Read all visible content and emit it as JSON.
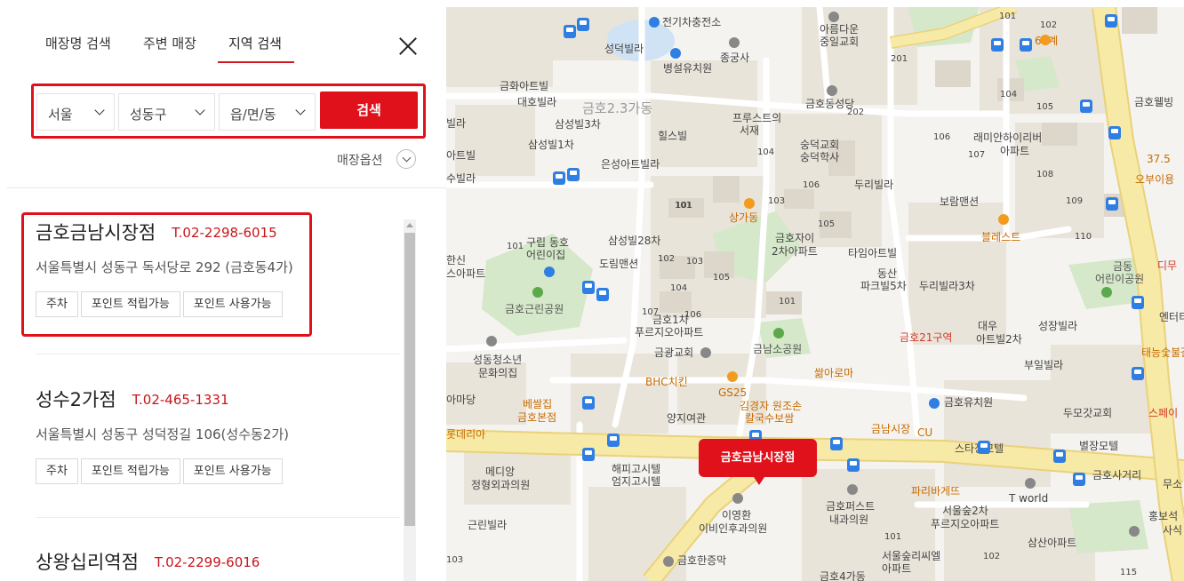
{
  "tabs": [
    {
      "label": "매장명 검색",
      "active": false
    },
    {
      "label": "주변 매장",
      "active": false
    },
    {
      "label": "지역 검색",
      "active": true
    }
  ],
  "search": {
    "city": "서울",
    "district": "성동구",
    "town": "읍/면/동",
    "button_label": "검색"
  },
  "store_options_label": "매장옵션",
  "stores": [
    {
      "name": "금호금남시장점",
      "tel": "T.02-2298-6015",
      "address": "서울특별시 성동구 독서당로 292 (금호동4가)",
      "tags": [
        "주차",
        "포인트 적립가능",
        "포인트 사용가능"
      ],
      "selected": true
    },
    {
      "name": "성수2가점",
      "tel": "T.02-465-1331",
      "address": "서울특별시 성동구 성덕정길 106(성수동2가)",
      "tags": [
        "주차",
        "포인트 적립가능",
        "포인트 사용가능"
      ],
      "selected": false
    },
    {
      "name": "상왕십리역점",
      "tel": "T.02-2299-6016",
      "address": "",
      "tags": [],
      "selected": false
    }
  ],
  "map": {
    "marker_label": "금호금남시장점",
    "labels": {
      "l1": "전기차충전소",
      "l2": "아름다운",
      "l3": "중일교회",
      "l4": "성덕빌라",
      "l5": "종궁사",
      "l6": "병설유치원",
      "l7": "금화아트빌",
      "l8": "대호빌라",
      "l9": "금호2.3가동",
      "l10": "금호동성당",
      "l11": "삼성빌3차",
      "l12": "프루스트의",
      "l13": "서재",
      "l14": "힐스빌",
      "l15": "숭덕교회",
      "l16": "숭덕학사",
      "l17": "삼성빌1차",
      "l18": "래미안하이리버",
      "l19": "아파트",
      "l20": "은성아트빌라",
      "l21": "두리빌라",
      "l22": "보람맨션",
      "l23": "상가동",
      "l24": "블레스트",
      "l25": "구립 동호",
      "l26": "어린이집",
      "l27": "삼성빌28차",
      "l28": "금호자이",
      "l29": "2차아파트",
      "l30": "타임아트빌",
      "l31": "도림맨션",
      "l32": "동산",
      "l33": "파크빌5차",
      "l34": "두리빌라3차",
      "l35": "금동",
      "l36": "어린이공원",
      "l37": "금호근린공원",
      "l38": "금호1차",
      "l39": "푸르지오아파트",
      "l40": "금광교회",
      "l41": "금남소공원",
      "l42": "대우",
      "l43": "아트빌2차",
      "l44": "성장빌라",
      "l45": "금호21구역",
      "l46": "성동청소년",
      "l47": "문화의집",
      "l48": "부일빌라",
      "l49": "BHC치킨",
      "l50": "GS25",
      "l51": "쌂아로마",
      "l52": "베쌀집",
      "l53": "금호본점",
      "l54": "김경자 원조손",
      "l55": "칼국수보쌈",
      "l56": "금호유치원",
      "l57": "양지여관",
      "l58": "두모갓교회",
      "l59": "금남시장",
      "l60": "CU",
      "l61": "스타장모텔",
      "l62": "별장모텔",
      "l63": "메디앙",
      "l64": "정형외과의원",
      "l65": "해피고시텔",
      "l66": "엄지고시텔",
      "l67": "금호퍼스트",
      "l68": "내과의원",
      "l69": "파리바게뜨",
      "l70": "금호사거리",
      "l71": "T world",
      "l72": "이영환",
      "l73": "이비인후과의원",
      "l74": "서울숲2차",
      "l75": "푸르지오아파트",
      "l76": "근린빌라",
      "l77": "삼산아파트",
      "l78": "금호한증막",
      "l79": "서울숲리씨엘",
      "l80": "아파트",
      "l81": "금호4가동",
      "l82": "60계",
      "l83": "37.5",
      "l84": "오부이용",
      "l85": "금호웰빙",
      "l86": "디무",
      "l87": "엔터티",
      "l88": "태능숯불갈",
      "l89": "스페이",
      "l90": "홍보석",
      "l91": "사식",
      "l92": "무소",
      "l93": "한신",
      "l94": "스아파트",
      "l95": "수빌라",
      "l96": "아트빌",
      "l97": "빌라",
      "l98": "아마당",
      "l99": "롯데리아",
      "l100": "금호동"
    },
    "numbers": {
      "n1": "101",
      "n2": "201",
      "n3": "104",
      "n4": "102",
      "n5": "202",
      "n6": "105",
      "n7": "106",
      "n8": "107",
      "n9": "108",
      "n10": "109",
      "n11": "110",
      "n12": "104",
      "n13": "103",
      "n14": "105",
      "n15": "106",
      "n16": "101",
      "n17": "102",
      "n18": "103",
      "n19": "104",
      "n20": "105",
      "n21": "107",
      "n22": "106",
      "n23": "101",
      "n24": "101",
      "n25": "103",
      "n26": "101",
      "n27": "102",
      "n28": "115",
      "n29": "101"
    },
    "colors": {
      "land": "#f4f3ef",
      "block": "#e9e4da",
      "building": "#dcd6cb",
      "park": "#d5e8c9",
      "road_major": "#f7e9a6",
      "road_major_edge": "#e9d27c",
      "road_minor": "#ffffff",
      "water": "#cfe3f4"
    }
  }
}
